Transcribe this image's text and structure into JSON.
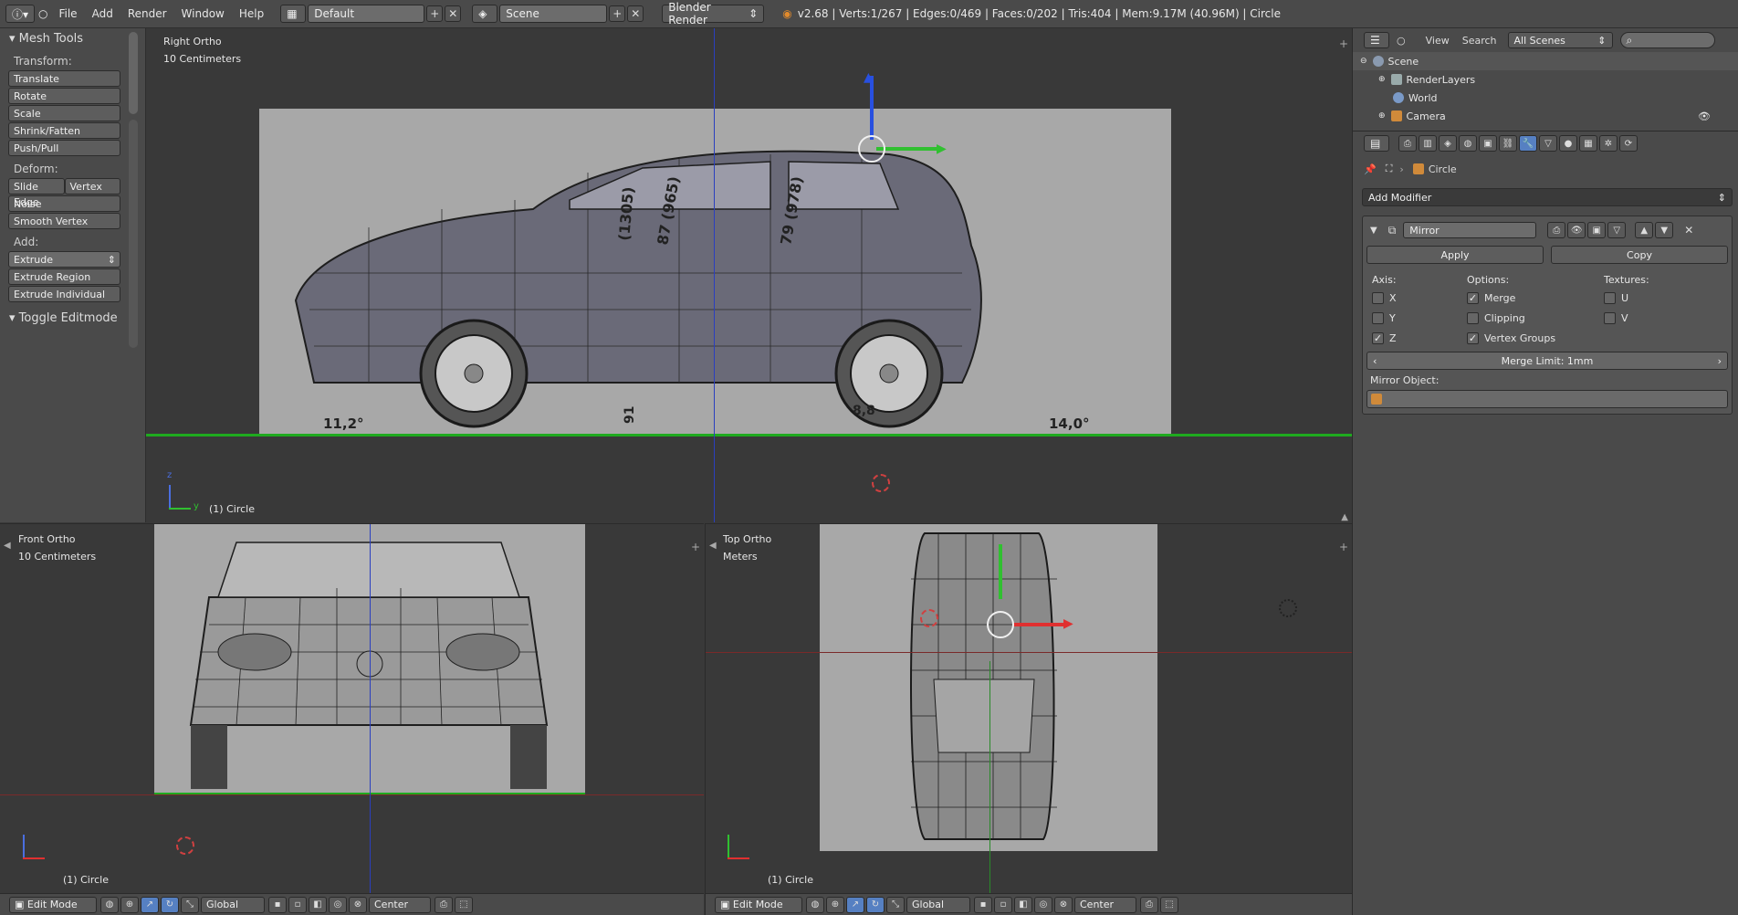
{
  "topbar": {
    "menus": [
      "File",
      "Add",
      "Render",
      "Window",
      "Help"
    ],
    "layout": "Default",
    "scene": "Scene",
    "engine": "Blender Render",
    "stats": "v2.68 | Verts:1/267 | Edges:0/469 | Faces:0/202 | Tris:404 | Mem:9.17M (40.96M) | Circle"
  },
  "toolshelf": {
    "title": "Mesh Tools",
    "transform_label": "Transform:",
    "transform": [
      "Translate",
      "Rotate",
      "Scale",
      "Shrink/Fatten",
      "Push/Pull"
    ],
    "deform_label": "Deform:",
    "slide_edge": "Slide Edge",
    "vertex": "Vertex",
    "noise": "Noise",
    "smooth_vertex": "Smooth Vertex",
    "add_label": "Add:",
    "extrude": "Extrude",
    "extrude_region": "Extrude Region",
    "extrude_individual": "Extrude Individual",
    "toggle_editmode": "Toggle Editmode"
  },
  "viewports": {
    "right": {
      "name": "Right Ortho",
      "scale": "10 Centimeters",
      "object": "(1) Circle"
    },
    "front": {
      "name": "Front Ortho",
      "scale": "10 Centimeters",
      "object": "(1) Circle"
    },
    "top": {
      "name": "Top Ortho",
      "scale": "Meters",
      "object": "(1) Circle"
    }
  },
  "blueprint_text": {
    "dim1": "(1305)",
    "dim2": "87 (965)",
    "dim3": "79 (978)",
    "angle1": "11,2°",
    "angle2": "14,0°",
    "dim4": "91",
    "dim5": "8,8"
  },
  "vp_header": {
    "mode": "Edit Mode",
    "orientation": "Global",
    "pivot": "Center"
  },
  "outliner": {
    "view": "View",
    "search": "Search",
    "filter": "All Scenes",
    "items": [
      "Scene",
      "RenderLayers",
      "World",
      "Camera"
    ]
  },
  "properties": {
    "object": "Circle",
    "add_modifier": "Add Modifier",
    "modifier_name": "Mirror",
    "apply": "Apply",
    "copy": "Copy",
    "axis_label": "Axis:",
    "options_label": "Options:",
    "textures_label": "Textures:",
    "axes": [
      {
        "label": "X",
        "checked": false
      },
      {
        "label": "Y",
        "checked": false
      },
      {
        "label": "Z",
        "checked": true
      }
    ],
    "options": [
      {
        "label": "Merge",
        "checked": true
      },
      {
        "label": "Clipping",
        "checked": false
      },
      {
        "label": "Vertex Groups",
        "checked": true
      }
    ],
    "textures": [
      {
        "label": "U",
        "checked": false
      },
      {
        "label": "V",
        "checked": false
      }
    ],
    "merge_limit": "Merge Limit: 1mm",
    "mirror_object_label": "Mirror Object:"
  },
  "colors": {
    "axis_x": "#e03030",
    "axis_y": "#30c030",
    "axis_z": "#2850e0",
    "accent": "#5680c2"
  }
}
